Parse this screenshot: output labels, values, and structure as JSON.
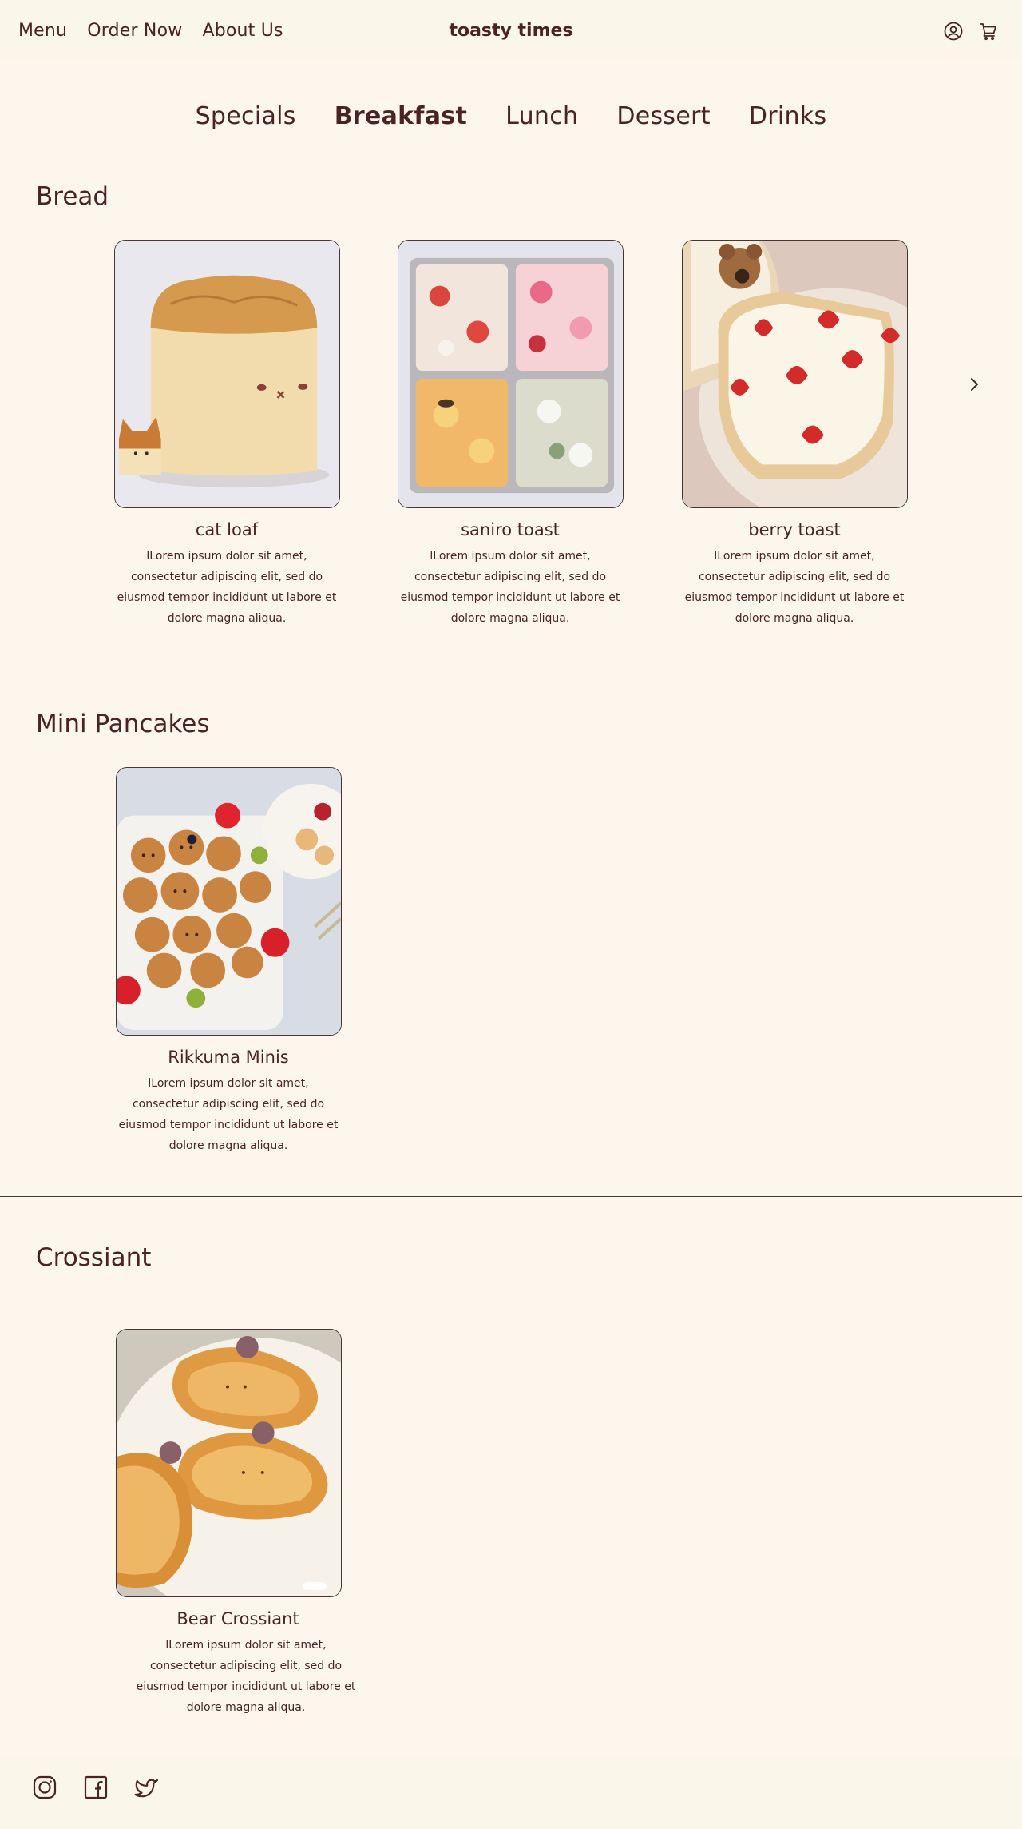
{
  "header": {
    "nav": [
      "Menu",
      "Order Now",
      "About Us"
    ],
    "brand": "toasty times",
    "icons": [
      "account-icon",
      "cart-icon"
    ]
  },
  "tabs": [
    {
      "label": "Specials",
      "active": false
    },
    {
      "label": "Breakfast",
      "active": true
    },
    {
      "label": "Lunch",
      "active": false
    },
    {
      "label": "Dessert",
      "active": false
    },
    {
      "label": "Drinks",
      "active": false
    }
  ],
  "sections": [
    {
      "title": "Bread",
      "items": [
        {
          "name": "cat loaf",
          "description": "lLorem ipsum dolor sit amet, consectetur adipiscing elit, sed do eiusmod tempor incididunt ut labore et dolore magna aliqua."
        },
        {
          "name": "saniro toast",
          "description": "lLorem ipsum dolor sit amet, consectetur adipiscing elit, sed do eiusmod tempor incididunt ut labore et dolore magna aliqua."
        },
        {
          "name": "berry toast",
          "description": "lLorem ipsum dolor sit amet, consectetur adipiscing elit, sed do eiusmod tempor incididunt ut labore et dolore magna aliqua."
        }
      ]
    },
    {
      "title": "Mini Pancakes",
      "items": [
        {
          "name": "Rikkuma Minis",
          "description": "lLorem ipsum dolor sit amet, consectetur adipiscing elit, sed do eiusmod tempor incididunt ut labore et dolore magna aliqua."
        }
      ]
    },
    {
      "title": "Crossiant",
      "items": [
        {
          "name": "Bear Crossiant",
          "description": "lLorem ipsum dolor sit amet, consectetur adipiscing elit, sed do eiusmod tempor incididunt ut labore et dolore magna aliqua."
        }
      ]
    }
  ],
  "footer": {
    "social": [
      "instagram-icon",
      "facebook-icon",
      "twitter-icon"
    ]
  },
  "colors": {
    "background": "#fdf6ec",
    "header_bg": "#fbf6ea",
    "text": "#4a2424",
    "border": "#4a3535"
  }
}
